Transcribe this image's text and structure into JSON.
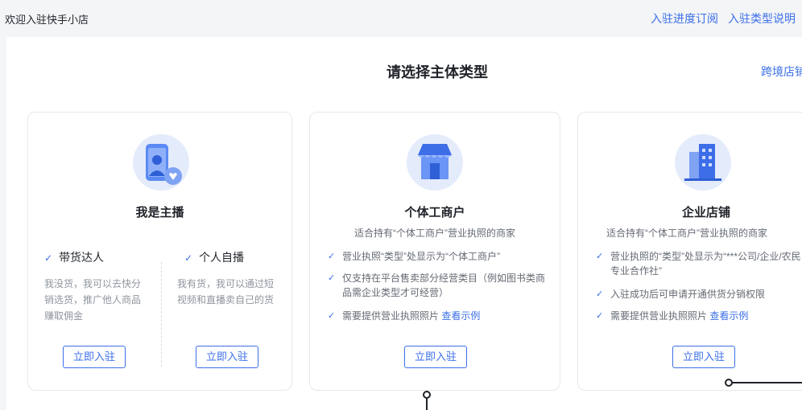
{
  "header": {
    "welcome": "欢迎入驻快手小店",
    "links": [
      "入驻进度订阅",
      "入驻类型说明"
    ]
  },
  "main": {
    "title": "请选择主体类型",
    "cross_border": "跨境店铺"
  },
  "cards": {
    "anchor": {
      "title": "我是主播",
      "options": [
        {
          "label": "带货达人",
          "desc": "我没货，我可以去快分销选货，推广他人商品赚取佣金",
          "button": "立即入驻"
        },
        {
          "label": "个人自播",
          "desc": "我有货，我可以通过短视频和直播卖自己的货",
          "button": "立即入驻"
        }
      ]
    },
    "individual": {
      "title": "个体工商户",
      "subtitle": "适合持有“个体工商户”营业执照的商家",
      "features": [
        "营业执照“类型”处显示为“个体工商户”",
        "仅支持在平台售卖部分经营类目（例如图书类商品需企业类型才可经营）",
        "需要提供营业执照照片"
      ],
      "example_link": "查看示例",
      "button": "立即入驻"
    },
    "enterprise": {
      "title": "企业店铺",
      "subtitle": "适合持有“个体工商户”营业执照的商家",
      "features": [
        "营业执照的“类型”处显示为“***公司/企业/农民专业合作社”",
        "入驻成功后可申请开通供货分销权限",
        "需要提供营业执照照片"
      ],
      "example_link": "查看示例",
      "button": "立即入驻"
    }
  },
  "colors": {
    "accent": "#3b6fe8",
    "icon_bg": "#e4ebfb"
  },
  "icons": [
    "check-icon",
    "phone-person-icon",
    "storefront-icon",
    "building-icon"
  ]
}
